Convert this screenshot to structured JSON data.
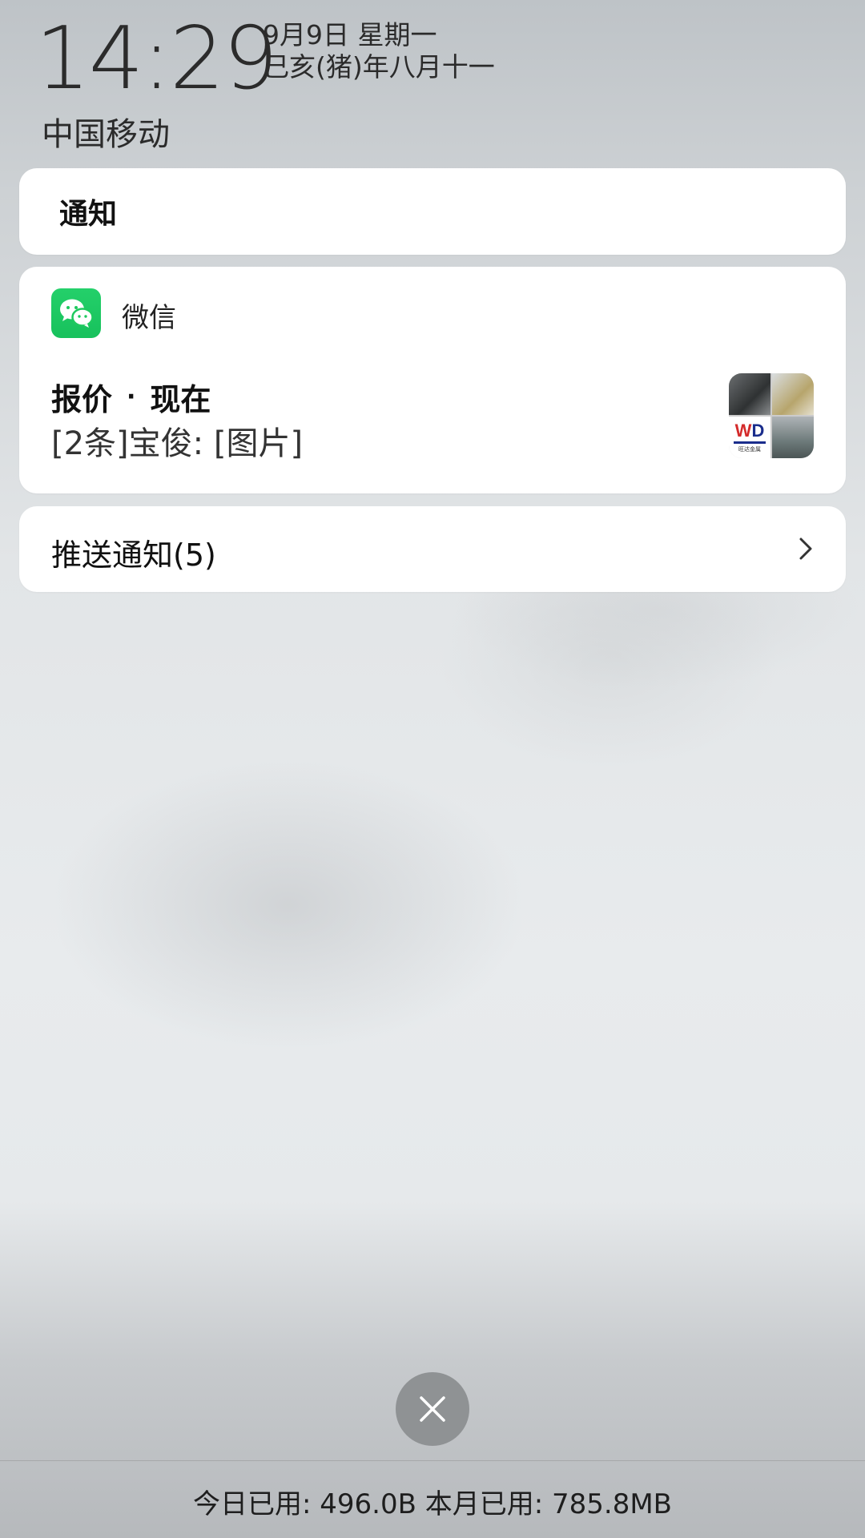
{
  "header": {
    "time": "14:29",
    "date": "9月9日 星期一",
    "lunar": "己亥(猪)年八月十一",
    "carrier": "中国移动"
  },
  "notifications_header": {
    "title": "通知"
  },
  "wechat_notification": {
    "app_name": "微信",
    "app_icon": "wechat-icon",
    "title": "报价",
    "separator": "·",
    "time": "现在",
    "body": "[2条]宝俊: [图片]",
    "thumbnail_logo_w": "W",
    "thumbnail_logo_d": "D",
    "thumbnail_caption": "旺达金属"
  },
  "push_notifications": {
    "label": "推送通知(5)"
  },
  "controls": {
    "close_icon": "close-icon"
  },
  "usage": {
    "text": "今日已用: 496.0B 本月已用: 785.8MB"
  },
  "colors": {
    "wechat_green": "#1ec95e",
    "card_bg": "#ffffff",
    "close_button_bg": "#8f9294"
  }
}
